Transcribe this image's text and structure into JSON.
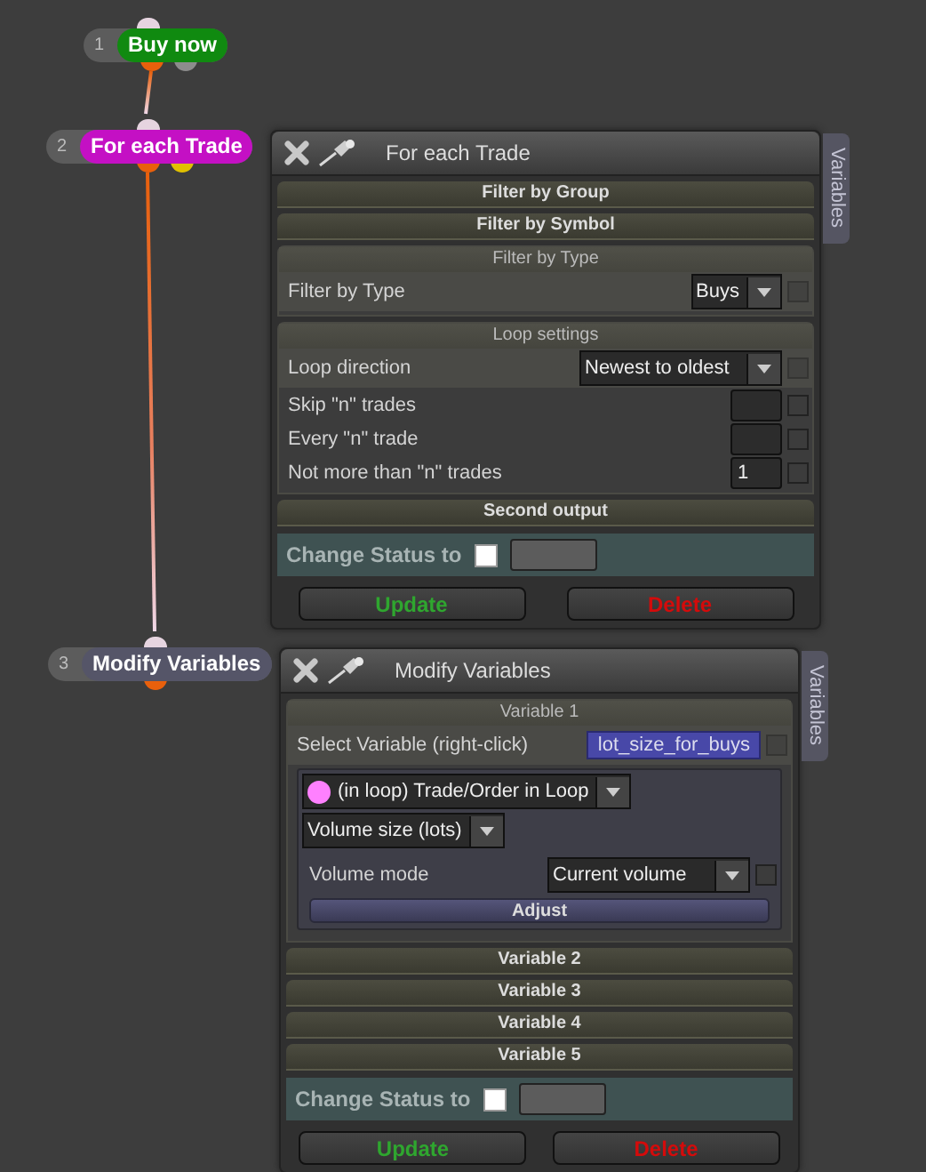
{
  "nodes": [
    {
      "number": "1",
      "label": "Buy now",
      "color": "#108a10",
      "outputs": [
        {
          "color": "#e8600c"
        },
        {
          "color": "#8c8c8c"
        }
      ]
    },
    {
      "number": "2",
      "label": "For each Trade",
      "color": "#c410c4",
      "outputs": [
        {
          "color": "#e8600c"
        },
        {
          "color": "#e0c000"
        }
      ]
    },
    {
      "number": "3",
      "label": "Modify Variables",
      "color": "#555568",
      "outputs": [
        {
          "color": "#e8600c"
        }
      ]
    }
  ],
  "panels": [
    {
      "title": "For each Trade",
      "tab": "Variables",
      "sections": [
        {
          "kind": "bar",
          "title": "Filter by Group"
        },
        {
          "kind": "bar",
          "title": "Filter by Symbol"
        },
        {
          "kind": "group",
          "title": "Filter by Type",
          "rows": [
            {
              "kind": "select",
              "label": "Filter by Type",
              "value": "Buys",
              "checked": false
            }
          ]
        },
        {
          "kind": "group",
          "title": "Loop settings",
          "rows": [
            {
              "kind": "select",
              "label": "Loop direction",
              "value": "Newest to oldest",
              "checked": false
            },
            {
              "kind": "input",
              "label": "Skip \"n\" trades",
              "checked": false
            },
            {
              "kind": "input",
              "label": "Every \"n\" trade",
              "checked": false
            },
            {
              "kind": "input",
              "label": "Not more than \"n\" trades",
              "value": "1",
              "checked": false
            }
          ]
        },
        {
          "kind": "bar",
          "title": "Second output"
        }
      ],
      "status_label": "Change Status to",
      "status_checked": false,
      "buttons": [
        {
          "label": "Update",
          "kind": "ok"
        },
        {
          "label": "Delete",
          "kind": "danger"
        }
      ]
    },
    {
      "title": "Modify Variables",
      "tab": "Variables",
      "sections": [
        {
          "kind": "group",
          "title": "Variable 1",
          "rows": [
            {
              "kind": "variable",
              "label": "Select Variable (right-click)",
              "value": "lot_size_for_buys",
              "checked": false
            },
            {
              "kind": "inner",
              "rows": [
                {
                  "kind": "dropdown",
                  "value": "(in loop) Trade/Order in Loop",
                  "color": "#ff80ff"
                },
                {
                  "kind": "dropdown",
                  "value": "Volume size (lots)"
                },
                {
                  "kind": "select",
                  "label": "Volume mode",
                  "value": "Current volume",
                  "checked": false
                },
                {
                  "kind": "button",
                  "label": "Adjust"
                }
              ]
            }
          ]
        },
        {
          "kind": "bar",
          "title": "Variable 2"
        },
        {
          "kind": "bar",
          "title": "Variable 3"
        },
        {
          "kind": "bar",
          "title": "Variable 4"
        },
        {
          "kind": "bar",
          "title": "Variable 5"
        }
      ],
      "status_label": "Change Status to",
      "status_checked": false,
      "buttons": [
        {
          "label": "Update",
          "kind": "ok"
        },
        {
          "label": "Delete",
          "kind": "danger"
        }
      ]
    }
  ]
}
